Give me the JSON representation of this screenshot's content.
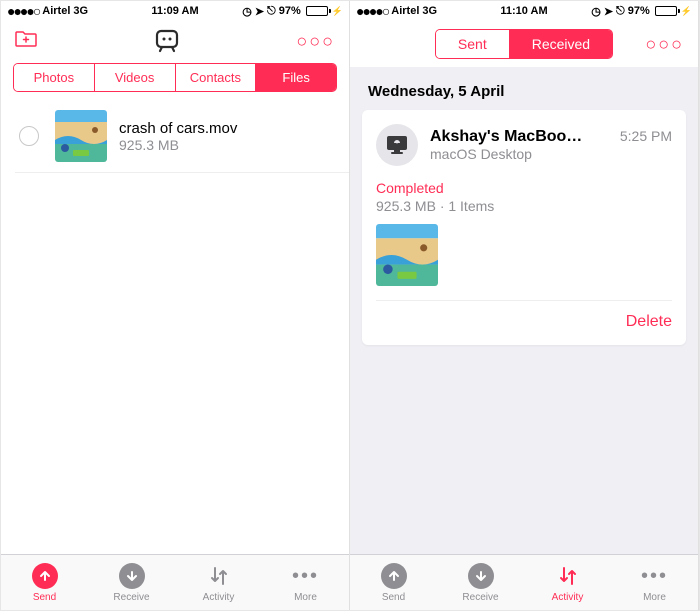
{
  "status": {
    "carrier": "Airtel",
    "network": "3G",
    "time_left": "11:09 AM",
    "time_right": "11:10 AM",
    "battery": "97%"
  },
  "left_screen": {
    "segments": [
      "Photos",
      "Videos",
      "Contacts",
      "Files"
    ],
    "active_segment": "Files",
    "file": {
      "name": "crash of cars.mov",
      "size": "925.3 MB"
    }
  },
  "right_screen": {
    "segments": [
      "Sent",
      "Received"
    ],
    "active_segment": "Received",
    "date_header": "Wednesday, 5 April",
    "transfer": {
      "device_name": "Akshay's MacBoo…",
      "device_type": "macOS Desktop",
      "time": "5:25 PM",
      "status": "Completed",
      "detail": "925.3 MB · 1 Items",
      "delete_label": "Delete"
    }
  },
  "tab_bar": {
    "send": "Send",
    "receive": "Receive",
    "activity": "Activity",
    "more": "More"
  }
}
